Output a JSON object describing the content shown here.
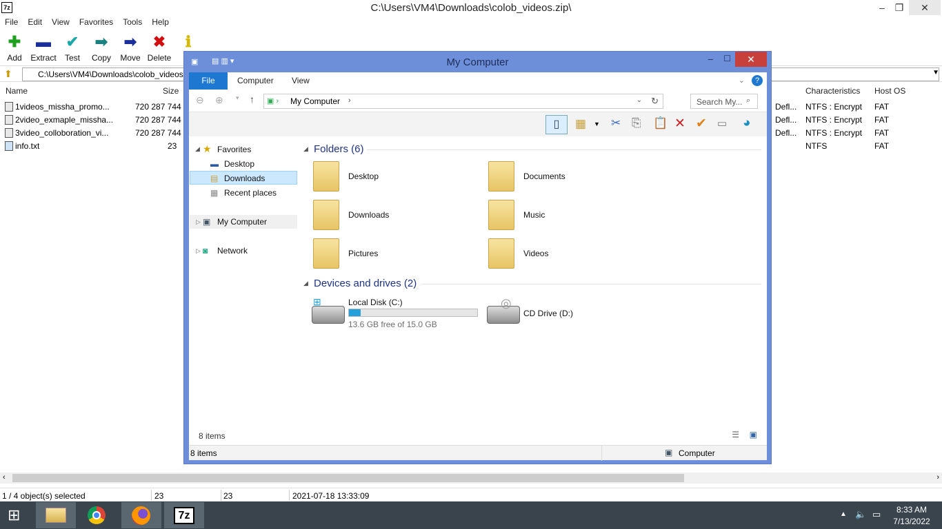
{
  "app": {
    "title": "C:\\Users\\VM4\\Downloads\\colob_videos.zip\\",
    "logo": "7z",
    "menu": [
      "File",
      "Edit",
      "View",
      "Favorites",
      "Tools",
      "Help"
    ],
    "toolbar": [
      {
        "label": "Add",
        "icon": "plus-icon",
        "color": "#1fa01f"
      },
      {
        "label": "Extract",
        "icon": "minus-icon",
        "color": "#1a2f9a"
      },
      {
        "label": "Test",
        "icon": "check-icon",
        "color": "#1aa8a8"
      },
      {
        "label": "Copy",
        "icon": "copy-arrow-icon",
        "color": "#1a8080"
      },
      {
        "label": "Move",
        "icon": "move-arrow-icon",
        "color": "#1a2f9a"
      },
      {
        "label": "Delete",
        "icon": "delete-x-icon",
        "color": "#d01010"
      },
      {
        "label": "I",
        "icon": "info-icon",
        "color": "#d6b800"
      }
    ],
    "address": "C:\\Users\\VM4\\Downloads\\colob_videos",
    "columns": {
      "name": "Name",
      "size": "Size",
      "characteristics": "Characteristics",
      "host_os": "Host OS"
    },
    "files": [
      {
        "name": "1videos_missha_promo...",
        "size": "720 287 744",
        "method": "Defl...",
        "characteristics": "NTFS : Encrypt",
        "host_os": "FAT"
      },
      {
        "name": "2video_exmaple_missha...",
        "size": "720 287 744",
        "method": "Defl...",
        "characteristics": "NTFS : Encrypt",
        "host_os": "FAT"
      },
      {
        "name": "3video_colloboration_vi...",
        "size": "720 287 744",
        "method": "Defl...",
        "characteristics": "NTFS : Encrypt",
        "host_os": "FAT"
      },
      {
        "name": "info.txt",
        "size": "23",
        "method": "",
        "characteristics": "NTFS",
        "host_os": "FAT"
      }
    ],
    "status": {
      "selection": "1 / 4 object(s) selected",
      "size": "23",
      "packed": "23",
      "modified": "2021-07-18 13:33:09"
    }
  },
  "explorer": {
    "title": "My Computer",
    "tabs": [
      "File",
      "Computer",
      "View"
    ],
    "breadcrumb": "My Computer",
    "search_placeholder": "Search My...",
    "nav": {
      "favorites": "Favorites",
      "fav_items": [
        "Desktop",
        "Downloads",
        "Recent places"
      ],
      "my_computer": "My Computer",
      "network": "Network"
    },
    "folders_header": "Folders (6)",
    "folders": [
      "Desktop",
      "Documents",
      "Downloads",
      "Music",
      "Pictures",
      "Videos"
    ],
    "drives_header": "Devices and drives (2)",
    "drives": [
      {
        "name": "Local Disk (C:)",
        "free": "13.6 GB free of 15.0 GB",
        "used_fraction": 0.09
      },
      {
        "name": "CD Drive (D:)"
      }
    ],
    "items_count": "8 items",
    "status_items": "8 items",
    "status_location": "Computer",
    "accent": "#1e78d2"
  },
  "taskbar": {
    "time": "8:33 AM",
    "date": "7/13/2022",
    "apps": [
      "file-explorer-icon",
      "chrome-icon",
      "firefox-icon",
      "7zip-icon"
    ]
  }
}
